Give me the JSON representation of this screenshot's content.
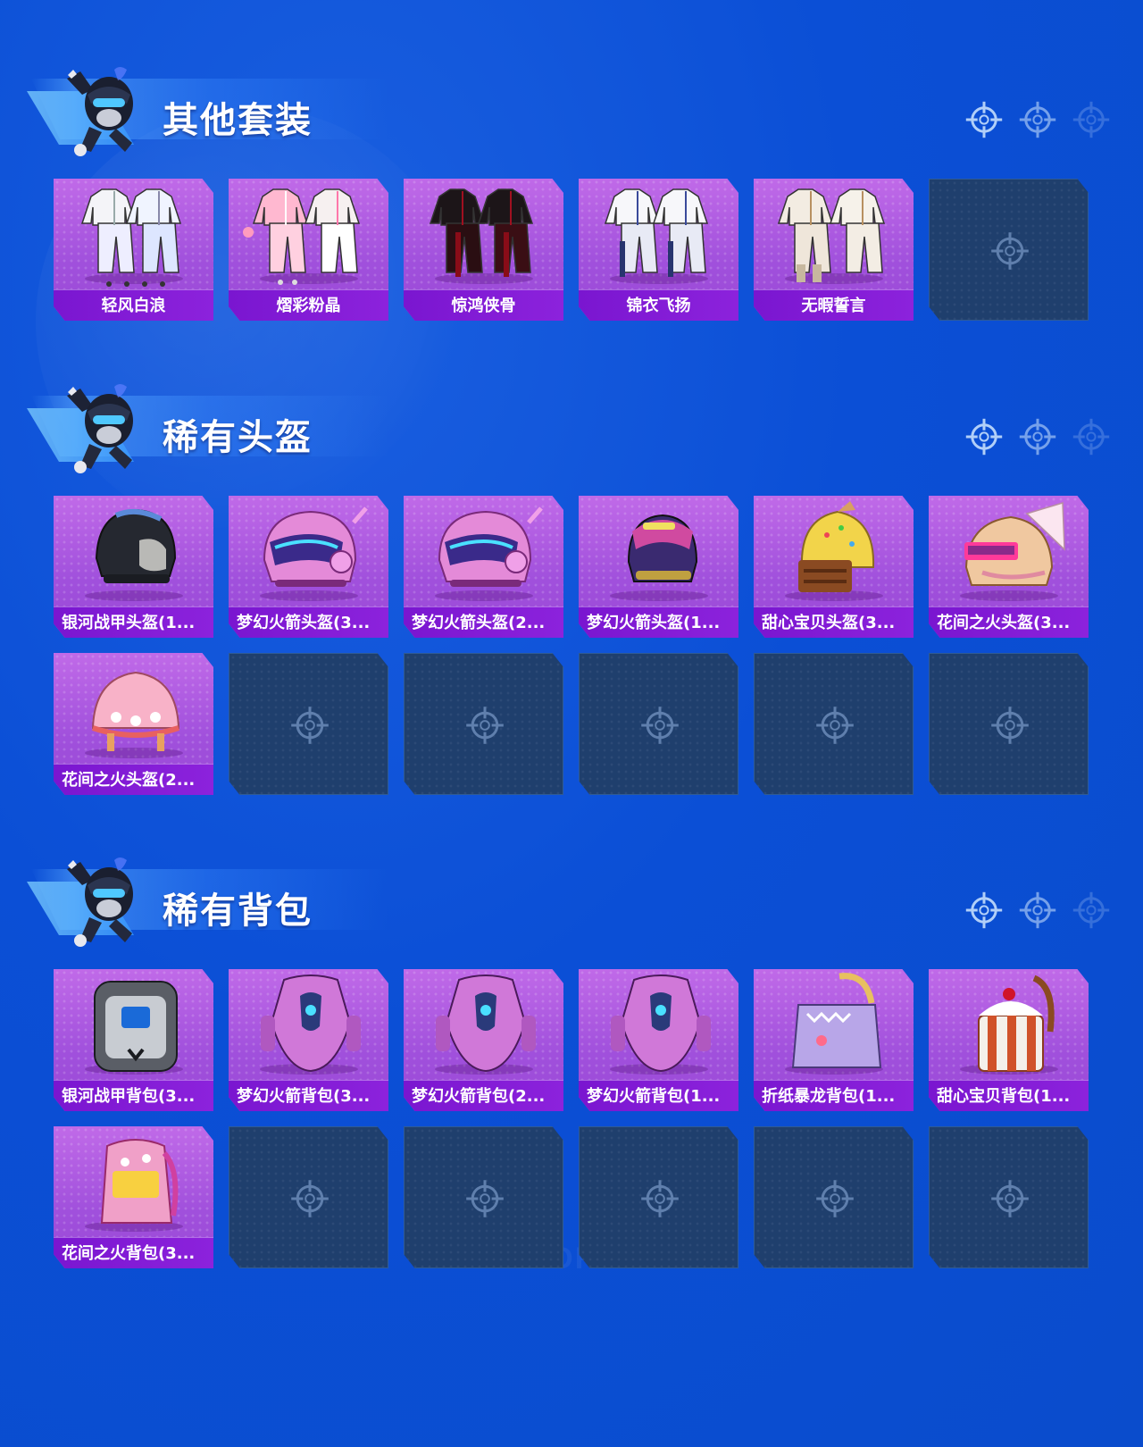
{
  "colors": {
    "background": "#0b4fd6",
    "card_fill": "#a050dc",
    "label_bar": "#7a16d0",
    "empty_card": "#1f3f6d",
    "title_text": "#ffffff"
  },
  "watermark": "GAME FOR PEACE",
  "sections": [
    {
      "title": "其他套装",
      "items": [
        {
          "name": "轻风白浪",
          "art": "white-outfit"
        },
        {
          "name": "熠彩粉晶",
          "art": "pink-outfit"
        },
        {
          "name": "惊鸿侠骨",
          "art": "black-red-robe"
        },
        {
          "name": "锦衣飞扬",
          "art": "white-blue-robe"
        },
        {
          "name": "无暇誓言",
          "art": "white-gold-outfit"
        }
      ],
      "empty_slots": 1
    },
    {
      "title": "稀有头盔",
      "items": [
        {
          "name": "银河战甲头盔(1...",
          "art": "helmet-black"
        },
        {
          "name": "梦幻火箭头盔(3...",
          "art": "helmet-rocket-pink"
        },
        {
          "name": "梦幻火箭头盔(2...",
          "art": "helmet-rocket-pink"
        },
        {
          "name": "梦幻火箭头盔(1...",
          "art": "helmet-purple"
        },
        {
          "name": "甜心宝贝头盔(3...",
          "art": "helmet-cake"
        },
        {
          "name": "花间之火头盔(3...",
          "art": "helmet-flower"
        },
        {
          "name": "花间之火头盔(2...",
          "art": "helmet-flower-pink"
        }
      ],
      "empty_slots": 5
    },
    {
      "title": "稀有背包",
      "items": [
        {
          "name": "银河战甲背包(3...",
          "art": "bag-silver"
        },
        {
          "name": "梦幻火箭背包(3...",
          "art": "bag-rocket"
        },
        {
          "name": "梦幻火箭背包(2...",
          "art": "bag-rocket"
        },
        {
          "name": "梦幻火箭背包(1...",
          "art": "bag-rocket"
        },
        {
          "name": "折纸暴龙背包(1...",
          "art": "bag-dino"
        },
        {
          "name": "甜心宝贝背包(1...",
          "art": "bag-cake"
        },
        {
          "name": "花间之火背包(3...",
          "art": "bag-flower"
        }
      ],
      "empty_slots": 5
    }
  ]
}
